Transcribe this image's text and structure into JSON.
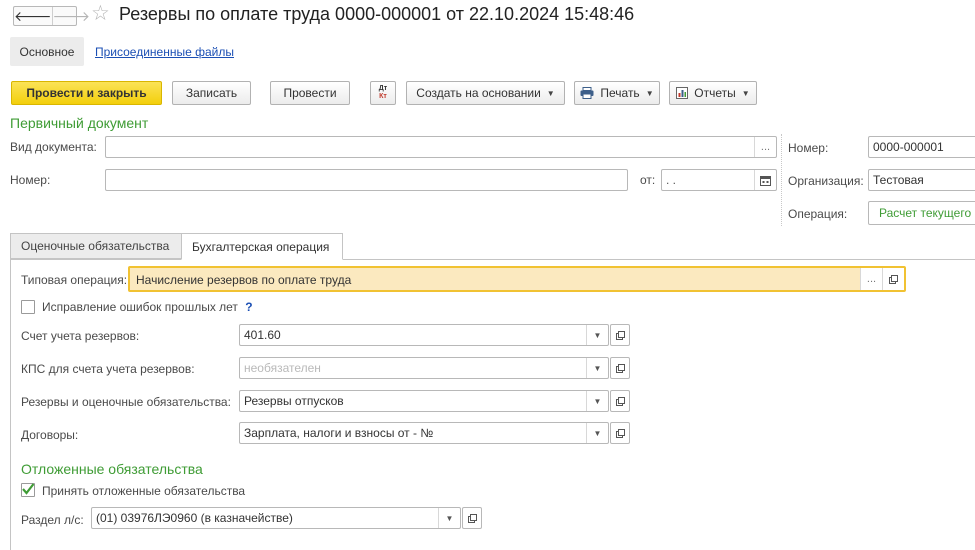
{
  "window": {
    "title": "Резервы по оплате труда 0000-000001 от 22.10.2024 15:48:46",
    "back_glyph": "🡐",
    "forward_glyph": "🡒",
    "star_glyph": "☆"
  },
  "tabs": {
    "main": "Основное",
    "attached": "Присоединенные файлы"
  },
  "toolbar": {
    "post_close": "Провести и закрыть",
    "save": "Записать",
    "post": "Провести",
    "dtkt_top": "Дт",
    "dtkt_bottom": "Кт",
    "create_based": "Создать на основании",
    "print": "Печать",
    "reports": "Отчеты"
  },
  "primary_doc": {
    "header": "Первичный документ",
    "doc_type_label": "Вид документа:",
    "doc_type_value": "",
    "number_label": "Номер:",
    "number_value": "",
    "date_label": "от:",
    "date_value": " .  ."
  },
  "doc_info": {
    "number_label": "Номер:",
    "number_value": "0000-000001",
    "org_label": "Организация:",
    "org_value": "Тестовая",
    "operation_label": "Операция:",
    "operation_value": "Расчет текущего"
  },
  "inner_tabs": {
    "estimated": "Оценочные обязательства",
    "accounting": "Бухгалтерская операция"
  },
  "accounting": {
    "typical_op_label": "Типовая операция:",
    "typical_op_value": "Начисление резервов по оплате труда",
    "fix_errors_label": "Исправление ошибок прошлых лет",
    "help_glyph": "?",
    "reserve_account_label": "Счет учета резервов:",
    "reserve_account_value": "401.60",
    "kps_label": "КПС для счета учета резервов:",
    "kps_placeholder": "необязателен",
    "reserves_label": "Резервы и оценочные обязательства:",
    "reserves_value": "Резервы отпусков",
    "contracts_label": "Договоры:",
    "contracts_value": "Зарплата, налоги и взносы от - №"
  },
  "deferred": {
    "header": "Отложенные обязательства",
    "accept_label": "Принять отложенные обязательства",
    "accept_checked": true,
    "section_label": "Раздел л/с:",
    "section_value": "(01) 03976ЛЭ0960 (в казначействе)"
  },
  "colors": {
    "primary_button": "#f3cf0c",
    "section_header": "#3f9c35",
    "link": "#1b4fb4",
    "highlight_field": "#fbe9bf",
    "highlight_border": "#f1c232"
  }
}
